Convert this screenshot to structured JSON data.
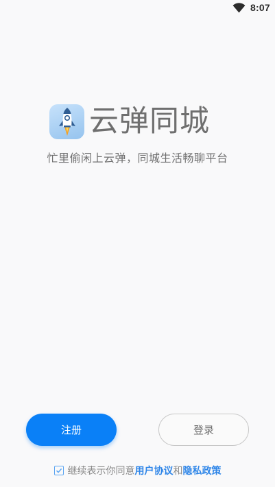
{
  "status_bar": {
    "time": "8:07",
    "icons": [
      "wifi-icon"
    ]
  },
  "brand": {
    "app_name": "云弹同城",
    "logo_icon": "rocket-icon",
    "slogan": "忙里偷闲上云弹，同城生活畅聊平台"
  },
  "actions": {
    "register_label": "注册",
    "login_label": "登录"
  },
  "agreement": {
    "checked": true,
    "prefix": "继续表示你同意",
    "user_agreement": "用户协议",
    "conjunction": "和",
    "privacy_policy": "隐私政策"
  },
  "colors": {
    "primary": "#0a80f7",
    "link": "#2f86e8",
    "background": "#f9f9fa",
    "text_gray": "#707070"
  }
}
